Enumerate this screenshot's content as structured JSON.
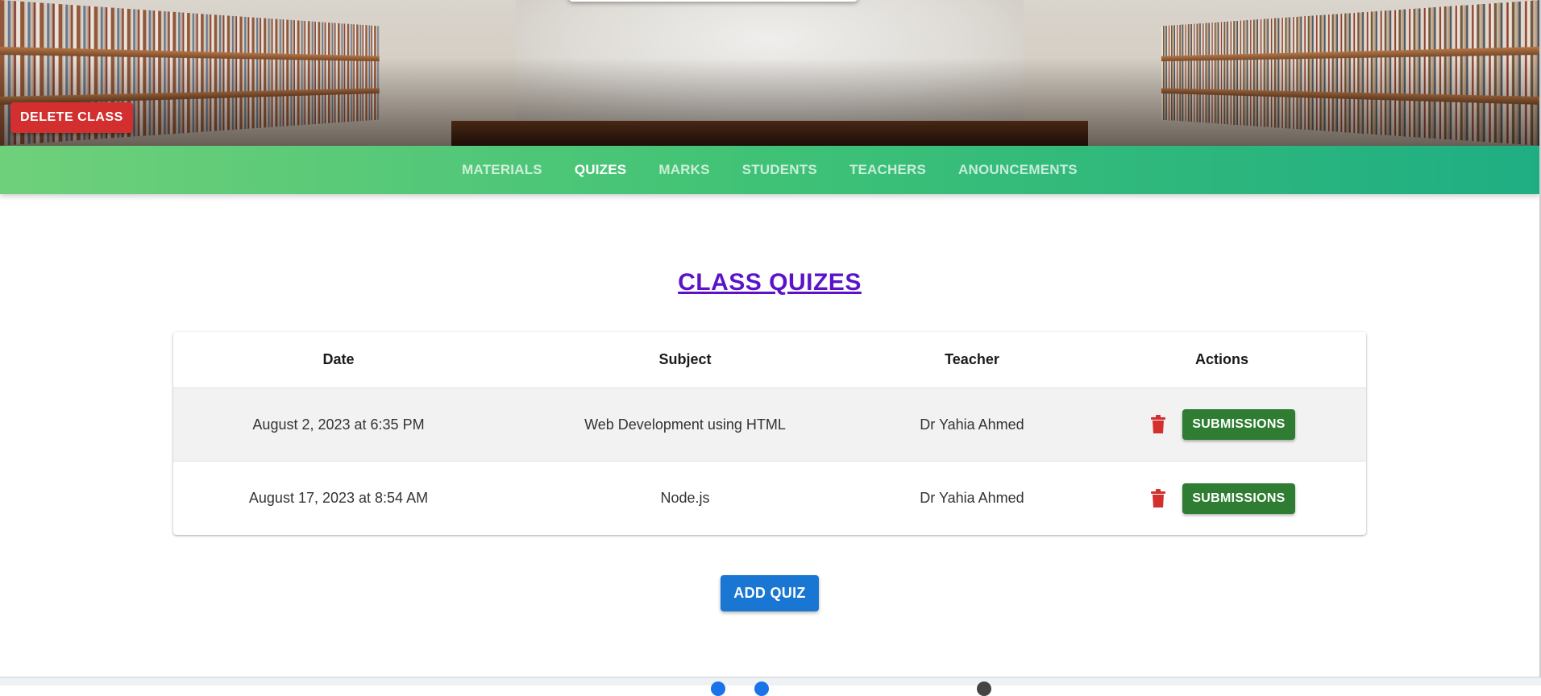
{
  "header": {
    "delete_class_label": "DELETE CLASS"
  },
  "nav": {
    "items": [
      {
        "label": "MATERIALS",
        "active": false
      },
      {
        "label": "QUIZES",
        "active": true
      },
      {
        "label": "MARKS",
        "active": false
      },
      {
        "label": "STUDENTS",
        "active": false
      },
      {
        "label": "TEACHERS",
        "active": false
      },
      {
        "label": "ANOUNCEMENTS",
        "active": false
      }
    ]
  },
  "main": {
    "title": "CLASS QUIZES",
    "table": {
      "columns": [
        "Date",
        "Subject",
        "Teacher",
        "Actions"
      ],
      "rows": [
        {
          "date": "August 2, 2023 at 6:35 PM",
          "subject": "Web Development using HTML",
          "teacher": "Dr Yahia Ahmed",
          "action_label": "SUBMISSIONS",
          "delete_icon": "trash-icon"
        },
        {
          "date": "August 17, 2023 at 8:54 AM",
          "subject": "Node.js",
          "teacher": "Dr Yahia Ahmed",
          "action_label": "SUBMISSIONS",
          "delete_icon": "trash-icon"
        }
      ]
    },
    "add_quiz_label": "ADD QUIZ"
  },
  "colors": {
    "nav_gradient_start": "#6fd07a",
    "nav_gradient_end": "#1fae83",
    "delete_red": "#d32f2f",
    "submissions_green": "#2e7d32",
    "add_blue": "#1976d2",
    "title_purple": "#5b13c9"
  }
}
